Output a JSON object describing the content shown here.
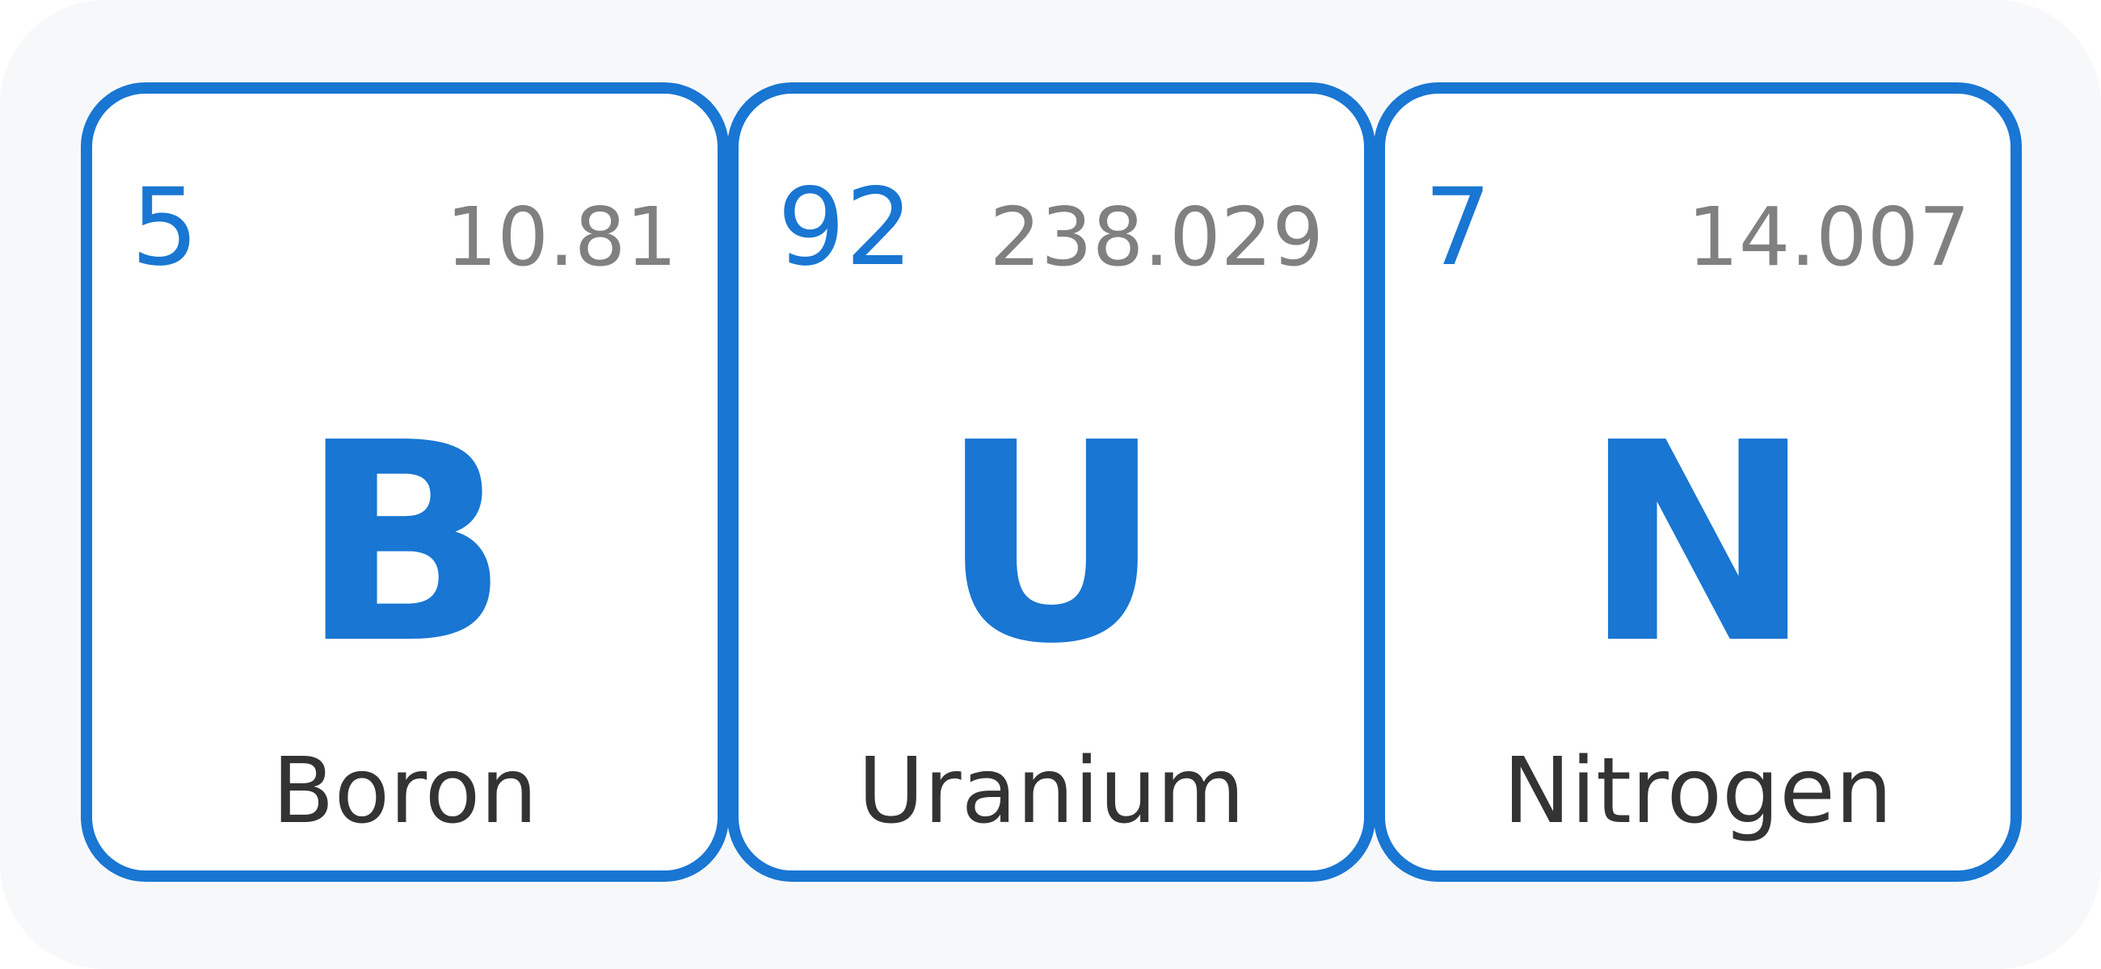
{
  "colors": {
    "accent": "#1976d2",
    "mass_text": "#808080",
    "name_text": "#333333",
    "tile_background": "#ffffff",
    "panel_background": "#f7f8fa"
  },
  "tiles": [
    {
      "atomic_number": "5",
      "atomic_mass": "10.81",
      "symbol": "B",
      "name": "Boron"
    },
    {
      "atomic_number": "92",
      "atomic_mass": "238.029",
      "symbol": "U",
      "name": "Uranium"
    },
    {
      "atomic_number": "7",
      "atomic_mass": "14.007",
      "symbol": "N",
      "name": "Nitrogen"
    }
  ]
}
